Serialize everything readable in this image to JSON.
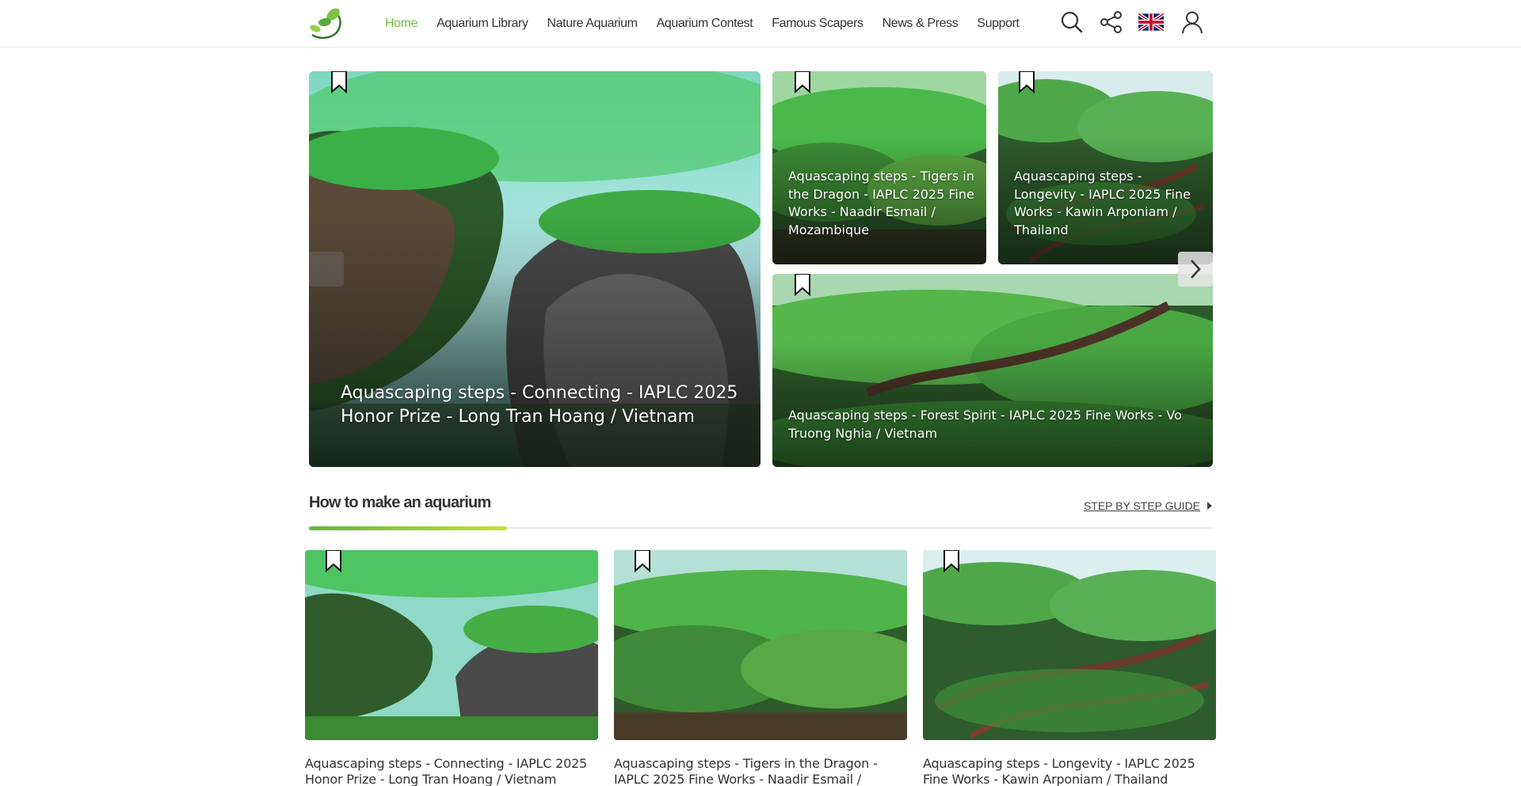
{
  "header": {
    "nav": [
      {
        "label": "Home",
        "active": true
      },
      {
        "label": "Aquarium Library",
        "active": false
      },
      {
        "label": "Nature Aquarium",
        "active": false
      },
      {
        "label": "Aquarium Contest",
        "active": false
      },
      {
        "label": "Famous Scapers",
        "active": false
      },
      {
        "label": "News & Press",
        "active": false
      },
      {
        "label": "Support",
        "active": false
      }
    ],
    "icons": [
      "search-icon",
      "share-icon",
      "uk-flag-icon",
      "user-icon"
    ],
    "accent_color": "#6cbf3d"
  },
  "hero": {
    "main": {
      "title": "Aquascaping steps - Connecting - IAPLC 2025 Honor Prize - Long Tran Hoang / Vietnam"
    },
    "top_middle": {
      "title": "Aquascaping steps - Tigers in the Dragon - IAPLC 2025 Fine Works - Naadir Esmail / Mozambique"
    },
    "top_right": {
      "title": "Aquascaping steps - Longevity - IAPLC 2025 Fine Works - Kawin Arponiam / Thailand"
    },
    "bottom_wide": {
      "title": "Aquascaping steps - Forest Spirit - IAPLC 2025 Fine Works - Vo Truong Nghia / Vietnam"
    },
    "prev_icon": "chevron-left-icon",
    "next_icon": "chevron-right-icon"
  },
  "section": {
    "title": "How to make an aquarium",
    "link_label": "STEP BY STEP GUIDE",
    "link_icon": "caret-right-icon"
  },
  "cards": [
    {
      "title": "Aquascaping steps - Connecting - IAPLC 2025 Honor Prize - Long Tran Hoang / Vietnam"
    },
    {
      "title": "Aquascaping steps - Tigers in the Dragon - IAPLC 2025 Fine Works - Naadir Esmail / Mozambique"
    },
    {
      "title": "Aquascaping steps - Longevity - IAPLC 2025 Fine Works - Kawin Arponiam / Thailand"
    }
  ]
}
